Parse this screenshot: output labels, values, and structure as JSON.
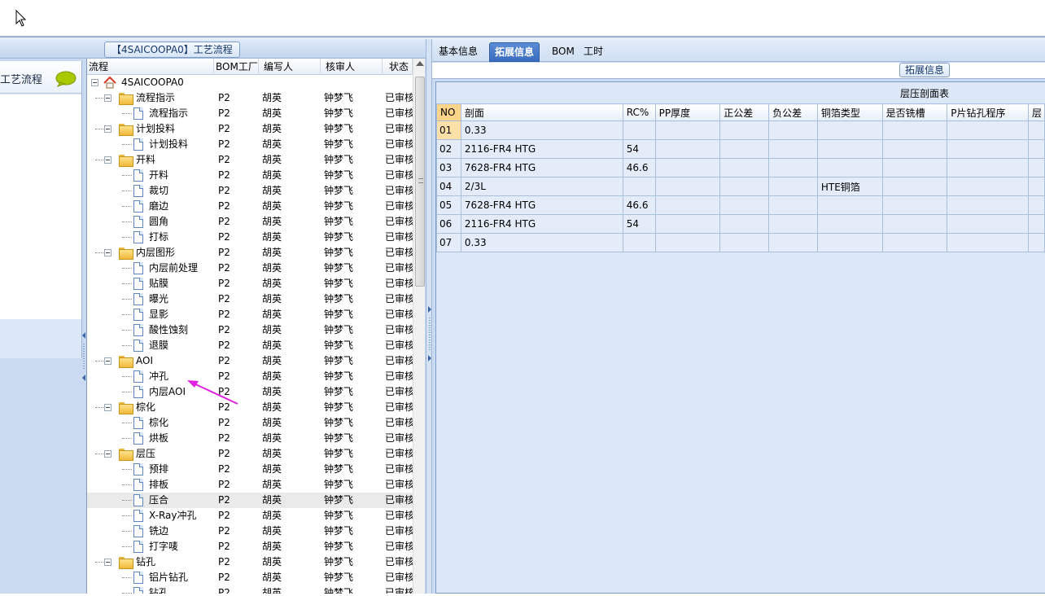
{
  "left": {
    "panel_title": "【4SAICOOPA0】工艺流程",
    "mini_title": "工艺流程",
    "tree": {
      "columns": [
        "流程",
        "BOM工厂",
        "编写人",
        "核审人",
        "状态"
      ],
      "rows": [
        {
          "level": 0,
          "type": "root",
          "name": "4SAICOOPA0",
          "bom": "",
          "writer": "",
          "reviewer": "",
          "status": ""
        },
        {
          "level": 1,
          "type": "folder",
          "name": "流程指示",
          "bom": "P2",
          "writer": "胡英",
          "reviewer": "钟梦飞",
          "status": "已审核"
        },
        {
          "level": 2,
          "type": "doc",
          "name": "流程指示",
          "bom": "P2",
          "writer": "胡英",
          "reviewer": "钟梦飞",
          "status": "已审核"
        },
        {
          "level": 1,
          "type": "folder",
          "name": "计划投料",
          "bom": "P2",
          "writer": "胡英",
          "reviewer": "钟梦飞",
          "status": "已审核"
        },
        {
          "level": 2,
          "type": "doc",
          "name": "计划投料",
          "bom": "P2",
          "writer": "胡英",
          "reviewer": "钟梦飞",
          "status": "已审核"
        },
        {
          "level": 1,
          "type": "folder",
          "name": "开料",
          "bom": "P2",
          "writer": "胡英",
          "reviewer": "钟梦飞",
          "status": "已审核"
        },
        {
          "level": 2,
          "type": "doc",
          "name": "开料",
          "bom": "P2",
          "writer": "胡英",
          "reviewer": "钟梦飞",
          "status": "已审核"
        },
        {
          "level": 2,
          "type": "doc",
          "name": "裁切",
          "bom": "P2",
          "writer": "胡英",
          "reviewer": "钟梦飞",
          "status": "已审核"
        },
        {
          "level": 2,
          "type": "doc",
          "name": "磨边",
          "bom": "P2",
          "writer": "胡英",
          "reviewer": "钟梦飞",
          "status": "已审核"
        },
        {
          "level": 2,
          "type": "doc",
          "name": "圆角",
          "bom": "P2",
          "writer": "胡英",
          "reviewer": "钟梦飞",
          "status": "已审核"
        },
        {
          "level": 2,
          "type": "doc",
          "name": "打标",
          "bom": "P2",
          "writer": "胡英",
          "reviewer": "钟梦飞",
          "status": "已审核"
        },
        {
          "level": 1,
          "type": "folder",
          "name": "内层图形",
          "bom": "P2",
          "writer": "胡英",
          "reviewer": "钟梦飞",
          "status": "已审核"
        },
        {
          "level": 2,
          "type": "doc",
          "name": "内层前处理",
          "bom": "P2",
          "writer": "胡英",
          "reviewer": "钟梦飞",
          "status": "已审核"
        },
        {
          "level": 2,
          "type": "doc",
          "name": "贴膜",
          "bom": "P2",
          "writer": "胡英",
          "reviewer": "钟梦飞",
          "status": "已审核"
        },
        {
          "level": 2,
          "type": "doc",
          "name": "曝光",
          "bom": "P2",
          "writer": "胡英",
          "reviewer": "钟梦飞",
          "status": "已审核"
        },
        {
          "level": 2,
          "type": "doc",
          "name": "显影",
          "bom": "P2",
          "writer": "胡英",
          "reviewer": "钟梦飞",
          "status": "已审核"
        },
        {
          "level": 2,
          "type": "doc",
          "name": "酸性蚀刻",
          "bom": "P2",
          "writer": "胡英",
          "reviewer": "钟梦飞",
          "status": "已审核"
        },
        {
          "level": 2,
          "type": "doc",
          "name": "退膜",
          "bom": "P2",
          "writer": "胡英",
          "reviewer": "钟梦飞",
          "status": "已审核"
        },
        {
          "level": 1,
          "type": "folder",
          "name": "AOI",
          "bom": "P2",
          "writer": "胡英",
          "reviewer": "钟梦飞",
          "status": "已审核"
        },
        {
          "level": 2,
          "type": "doc",
          "name": "冲孔",
          "bom": "P2",
          "writer": "胡英",
          "reviewer": "钟梦飞",
          "status": "已审核"
        },
        {
          "level": 2,
          "type": "doc",
          "name": "内层AOI",
          "bom": "P2",
          "writer": "胡英",
          "reviewer": "钟梦飞",
          "status": "已审核"
        },
        {
          "level": 1,
          "type": "folder",
          "name": "棕化",
          "bom": "P2",
          "writer": "胡英",
          "reviewer": "钟梦飞",
          "status": "已审核"
        },
        {
          "level": 2,
          "type": "doc",
          "name": "棕化",
          "bom": "P2",
          "writer": "胡英",
          "reviewer": "钟梦飞",
          "status": "已审核"
        },
        {
          "level": 2,
          "type": "doc",
          "name": "烘板",
          "bom": "P2",
          "writer": "胡英",
          "reviewer": "钟梦飞",
          "status": "已审核"
        },
        {
          "level": 1,
          "type": "folder",
          "name": "层压",
          "bom": "P2",
          "writer": "胡英",
          "reviewer": "钟梦飞",
          "status": "已审核"
        },
        {
          "level": 2,
          "type": "doc",
          "name": "预排",
          "bom": "P2",
          "writer": "胡英",
          "reviewer": "钟梦飞",
          "status": "已审核"
        },
        {
          "level": 2,
          "type": "doc",
          "name": "排板",
          "bom": "P2",
          "writer": "胡英",
          "reviewer": "钟梦飞",
          "status": "已审核"
        },
        {
          "level": 2,
          "type": "doc",
          "name": "压合",
          "bom": "P2",
          "writer": "胡英",
          "reviewer": "钟梦飞",
          "status": "已审核",
          "selected": true
        },
        {
          "level": 2,
          "type": "doc",
          "name": "X-Ray冲孔",
          "bom": "P2",
          "writer": "胡英",
          "reviewer": "钟梦飞",
          "status": "已审核"
        },
        {
          "level": 2,
          "type": "doc",
          "name": "铣边",
          "bom": "P2",
          "writer": "胡英",
          "reviewer": "钟梦飞",
          "status": "已审核"
        },
        {
          "level": 2,
          "type": "doc",
          "name": "打字唛",
          "bom": "P2",
          "writer": "胡英",
          "reviewer": "钟梦飞",
          "status": "已审核"
        },
        {
          "level": 1,
          "type": "folder",
          "name": "钻孔",
          "bom": "P2",
          "writer": "胡英",
          "reviewer": "钟梦飞",
          "status": "已审核"
        },
        {
          "level": 2,
          "type": "doc",
          "name": "铝片钻孔",
          "bom": "P2",
          "writer": "胡英",
          "reviewer": "钟梦飞",
          "status": "已审核"
        },
        {
          "level": 2,
          "type": "doc",
          "name": "钻孔",
          "bom": "P2",
          "writer": "胡英",
          "reviewer": "钟梦飞",
          "status": "已审核"
        }
      ]
    }
  },
  "right": {
    "tabs": [
      "基本信息",
      "拓展信息",
      "BOM",
      "工时"
    ],
    "active_tab": "拓展信息",
    "section_title": "拓展信息",
    "stack_table": {
      "title": "层压剖面表",
      "columns": [
        "NO",
        "剖面",
        "RC%",
        "PP厚度",
        "正公差",
        "负公差",
        "铜箔类型",
        "是否铣槽",
        "P片钻孔程序",
        "层"
      ],
      "rows": [
        [
          "01",
          "0.33",
          "",
          "",
          "",
          "",
          "",
          "",
          "",
          ""
        ],
        [
          "02",
          "2116-FR4 HTG",
          "54",
          "",
          "",
          "",
          "",
          "",
          "",
          ""
        ],
        [
          "03",
          "7628-FR4 HTG",
          "46.6",
          "",
          "",
          "",
          "",
          "",
          "",
          ""
        ],
        [
          "04",
          "2/3L",
          "",
          "",
          "",
          "",
          "HTE铜箔",
          "",
          "",
          ""
        ],
        [
          "05",
          "7628-FR4 HTG",
          "46.6",
          "",
          "",
          "",
          "",
          "",
          "",
          ""
        ],
        [
          "06",
          "2116-FR4 HTG",
          "54",
          "",
          "",
          "",
          "",
          "",
          "",
          ""
        ],
        [
          "07",
          "0.33",
          "",
          "",
          "",
          "",
          "",
          "",
          "",
          ""
        ]
      ]
    }
  },
  "colors": {
    "panel_bg": "#c9daf1",
    "active_tab": "#3a6bc0",
    "annotation_arrow": "#e020e0"
  }
}
